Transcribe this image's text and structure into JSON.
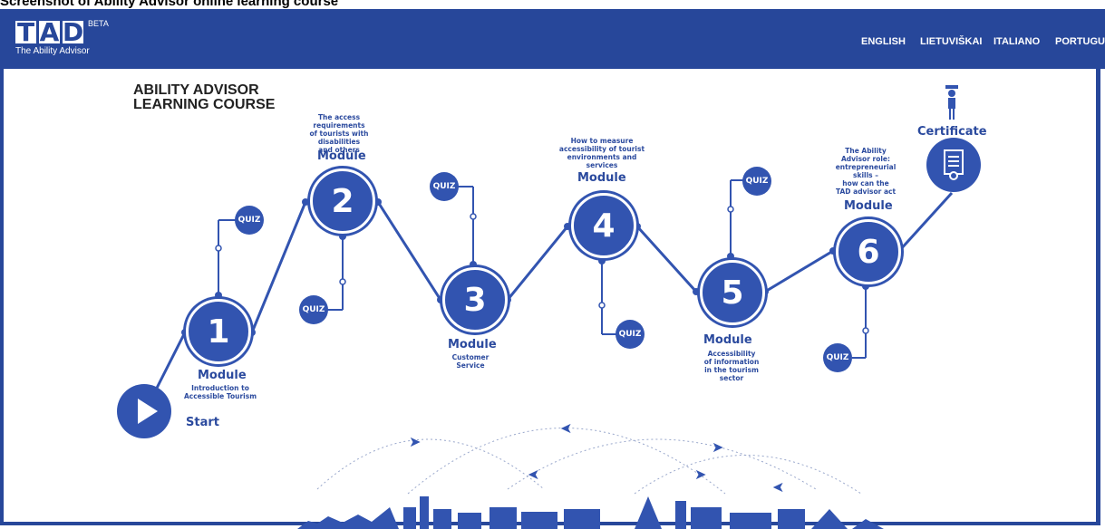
{
  "caption": "Screenshot of Ability Advisor online learning course",
  "header": {
    "logo_letters": [
      "T",
      "A",
      "D"
    ],
    "logo_beta": "BETA",
    "logo_sub": "The Ability Advisor",
    "languages": [
      "ENGLISH",
      "LIETUVIŠKAI",
      "ITALIANO",
      "PORTUGUÊS"
    ]
  },
  "course_title_line1": "ABILITY ADVISOR",
  "course_title_line2": "LEARNING COURSE",
  "start_label": "Start",
  "certificate_label": "Certificate",
  "quiz_label": "QUIZ",
  "module_word": "Module",
  "modules": [
    {
      "number": "1",
      "description": "Introduction to\nAccessible Tourism"
    },
    {
      "number": "2",
      "description": "The access\nrequirements\nof tourists with\ndisabilities\nand others"
    },
    {
      "number": "3",
      "description": "Customer\nService"
    },
    {
      "number": "4",
      "description": "How to measure\naccessibility of tourist\nenvironments and\nservices"
    },
    {
      "number": "5",
      "description": "Accessibility\nof information\nin the tourism\nsector"
    },
    {
      "number": "6",
      "description": "The Ability\nAdvisor role:\nentrepreneurial\nskills –\nhow can the\nTAD advisor act"
    }
  ],
  "colors": {
    "brand_blue": "#27479a",
    "node_blue": "#3254b0",
    "label_blue": "#2b4a9e"
  },
  "icons": [
    "play-icon",
    "certificate-icon",
    "graduate-icon",
    "airplane-icon",
    "skyline-landmarks"
  ]
}
